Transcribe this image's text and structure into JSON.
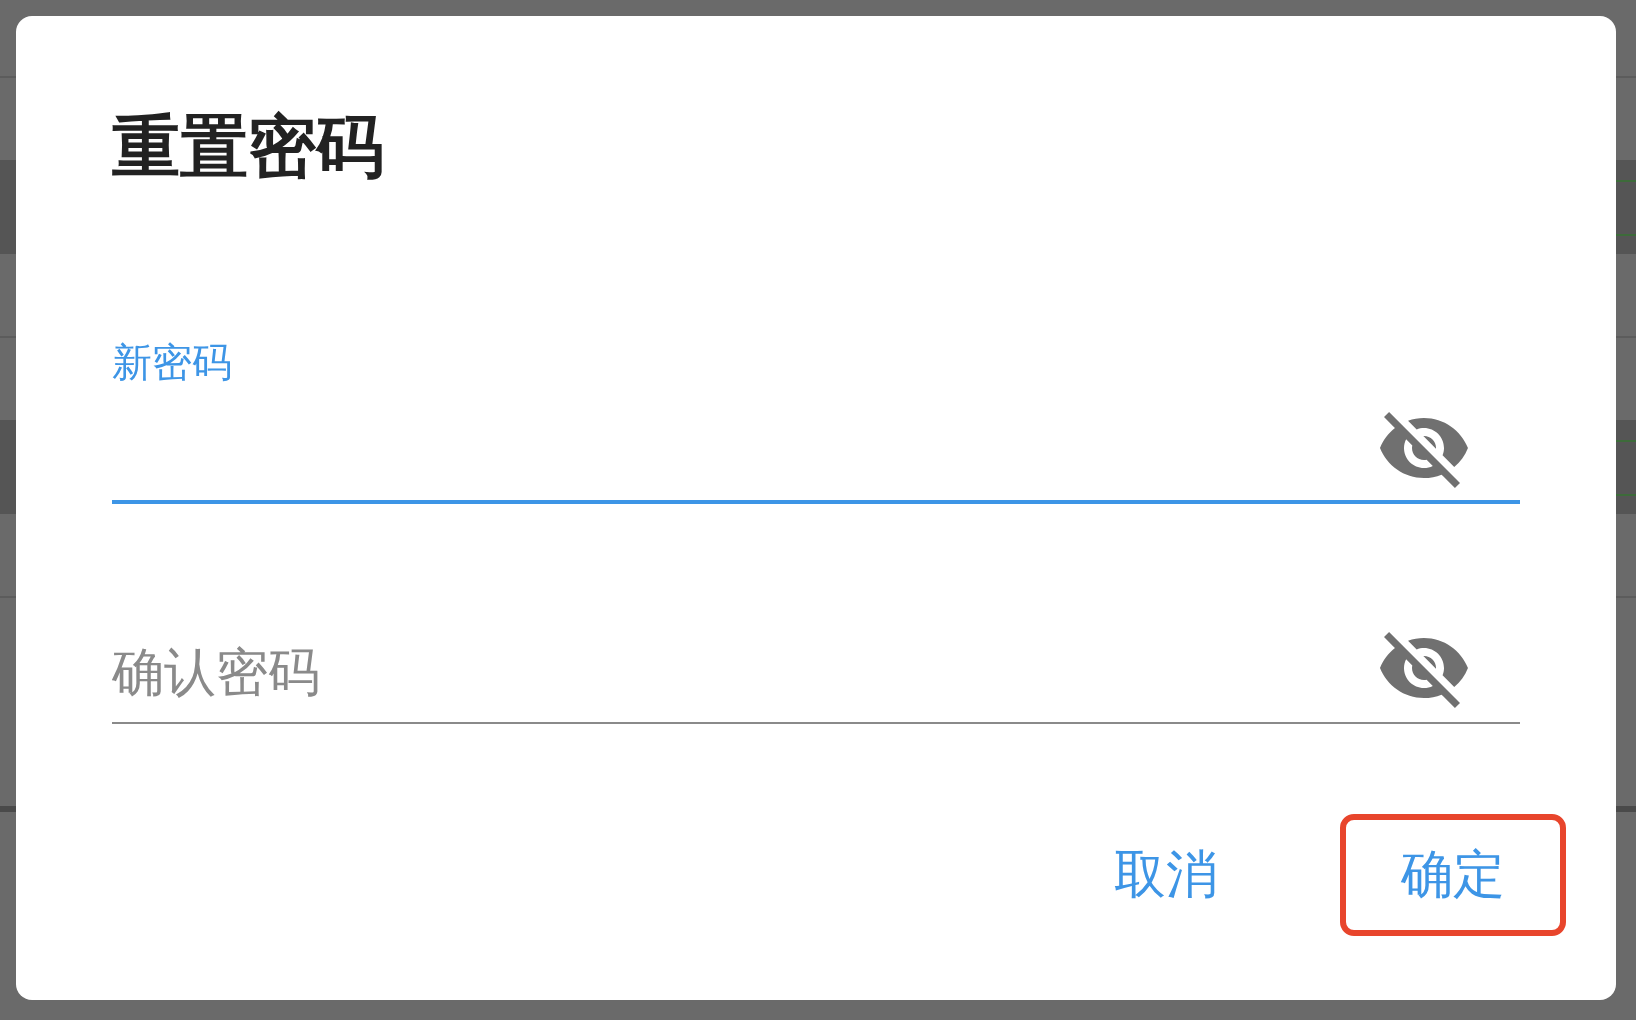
{
  "dialog": {
    "title": "重置密码",
    "fields": [
      {
        "label": "新密码",
        "focused": true,
        "password_visible": false
      },
      {
        "placeholder": "确认密码",
        "focused": false,
        "password_visible": false
      }
    ],
    "buttons": [
      {
        "label": "取消",
        "highlighted": false
      },
      {
        "label": "确定",
        "highlighted": true
      }
    ]
  }
}
